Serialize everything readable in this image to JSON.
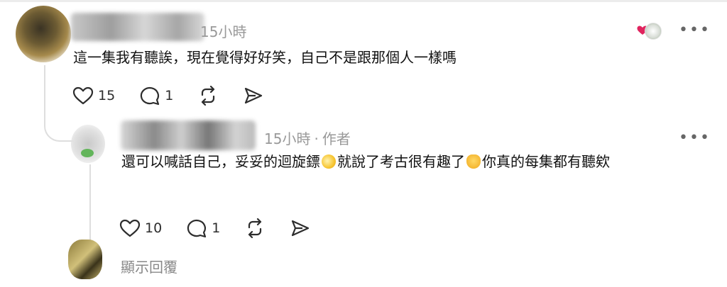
{
  "comment": {
    "time": "15小時",
    "text": "這一集我有聽誒，現在覺得好好笑，自己不是跟那個人一樣嗎",
    "like_count": "15",
    "reply_count": "1",
    "more_label": "•••"
  },
  "reply": {
    "time": "15小時",
    "separator": "·",
    "author_tag": "作者",
    "text_part1": "還可以喊話自己，妥妥的迴旋鏢",
    "text_part2": "就說了考古很有趣了",
    "text_part3": "你真的每集都有聽欸",
    "like_count": "10",
    "reply_count": "1",
    "more_label": "•••"
  },
  "show_replies_label": "顯示回覆",
  "icons": [
    "heart-icon",
    "comment-icon",
    "repost-icon",
    "share-icon",
    "more-icon",
    "pleading-face-icon",
    "cat-face-icon"
  ],
  "colors": {
    "heart": "#e0245e",
    "meta_text": "#999999",
    "text": "#111111"
  }
}
